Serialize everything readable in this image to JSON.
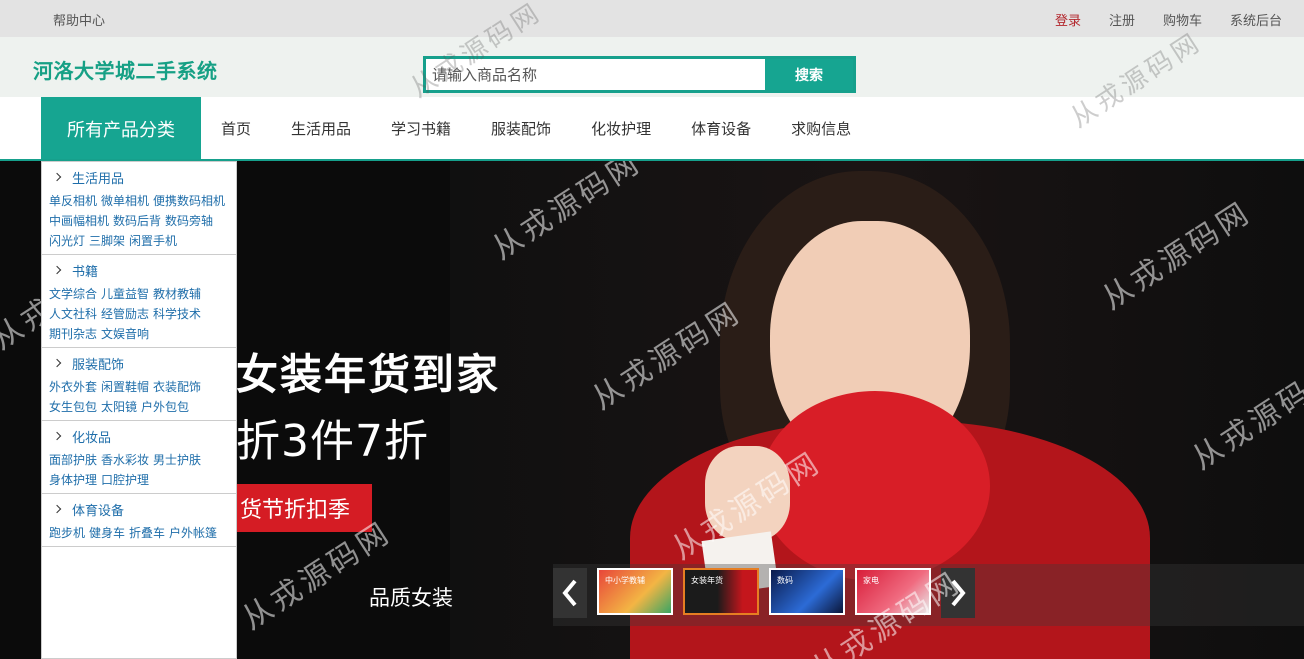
{
  "topbar": {
    "help": "帮助中心",
    "login": "登录",
    "register": "注册",
    "cart": "购物车",
    "admin": "系统后台"
  },
  "header": {
    "brand": "河洛大学城二手系统",
    "search_placeholder": "请输入商品名称",
    "search_button": "搜索"
  },
  "nav": {
    "all_categories": "所有产品分类",
    "items": [
      "首页",
      "生活用品",
      "学习书籍",
      "服装配饰",
      "化妆护理",
      "体育设备",
      "求购信息"
    ]
  },
  "categories": [
    {
      "name": "生活用品",
      "items": [
        "单反相机",
        "微单相机",
        "便携数码相机",
        "中画幅相机",
        "数码后背",
        "数码旁轴",
        "闪光灯",
        "三脚架",
        "闲置手机"
      ]
    },
    {
      "name": "书籍",
      "items": [
        "文学综合",
        "儿童益智",
        "教材教辅",
        "人文社科",
        "经管励志",
        "科学技术",
        "期刊杂志",
        "文娱音响"
      ]
    },
    {
      "name": "服装配饰",
      "items": [
        "外衣外套",
        "闲置鞋帽",
        "衣装配饰",
        "女生包包",
        "太阳镜",
        "户外包包"
      ]
    },
    {
      "name": "化妆品",
      "items": [
        "面部护肤",
        "香水彩妆",
        "男士护肤",
        "身体护理",
        "口腔护理"
      ]
    },
    {
      "name": "体育设备",
      "items": [
        "跑步机",
        "健身车",
        "折叠车",
        "户外帐篷"
      ]
    }
  ],
  "banner": {
    "headline": "女装年货到家",
    "subline": "折3件7折",
    "tag": "货节折扣季",
    "caption": "品质女装",
    "thumbnails": [
      "中小学教辅",
      "女装年货",
      "数码",
      "家电"
    ],
    "active_thumbnail": 1
  },
  "watermark": "从戎源码网",
  "colors": {
    "accent": "#16a591",
    "login": "#b3272d",
    "link": "#1f6eaa"
  }
}
